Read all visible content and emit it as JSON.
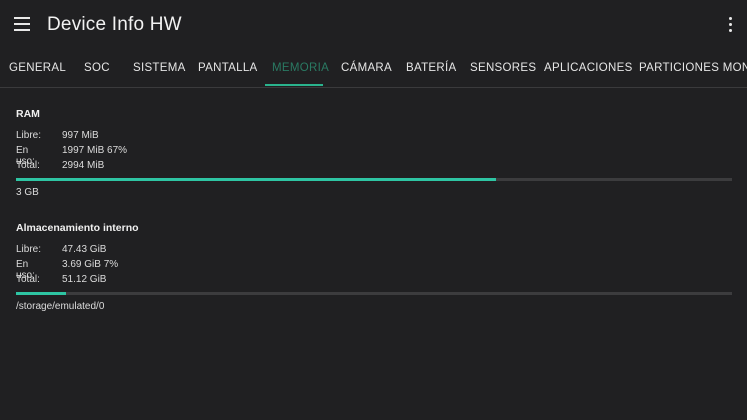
{
  "app": {
    "title": "Device Info HW"
  },
  "tabs": [
    {
      "label": "GENERAL"
    },
    {
      "label": "SOC"
    },
    {
      "label": "SISTEMA"
    },
    {
      "label": "PANTALLA"
    },
    {
      "label": "MEMORIA"
    },
    {
      "label": "CÁMARA"
    },
    {
      "label": "BATERÍA"
    },
    {
      "label": "SENSORES"
    },
    {
      "label": "APLICACIONES"
    },
    {
      "label": "PARTICIONES MONTA"
    }
  ],
  "active_tab": "MEMORIA",
  "ram": {
    "title": "RAM",
    "free_label": "Libre:",
    "free_value": "997 MiB",
    "used_label": "En uso:",
    "used_value": "1997 MiB 67%",
    "total_label": "Total:",
    "total_value": "2994 MiB",
    "usage_fraction": 0.67,
    "footnote": "3 GB"
  },
  "storage": {
    "title": "Almacenamiento interno",
    "free_label": "Libre:",
    "free_value": "47.43 GiB",
    "used_label": "En uso:",
    "used_value": "3.69 GiB 7%",
    "total_label": "Total:",
    "total_value": "51.12 GiB",
    "usage_fraction": 0.07,
    "footnote": "/storage/emulated/0"
  },
  "colors": {
    "accent": "#2ec5a3",
    "active_tab_text": "#2a7a63",
    "background": "#202022"
  }
}
